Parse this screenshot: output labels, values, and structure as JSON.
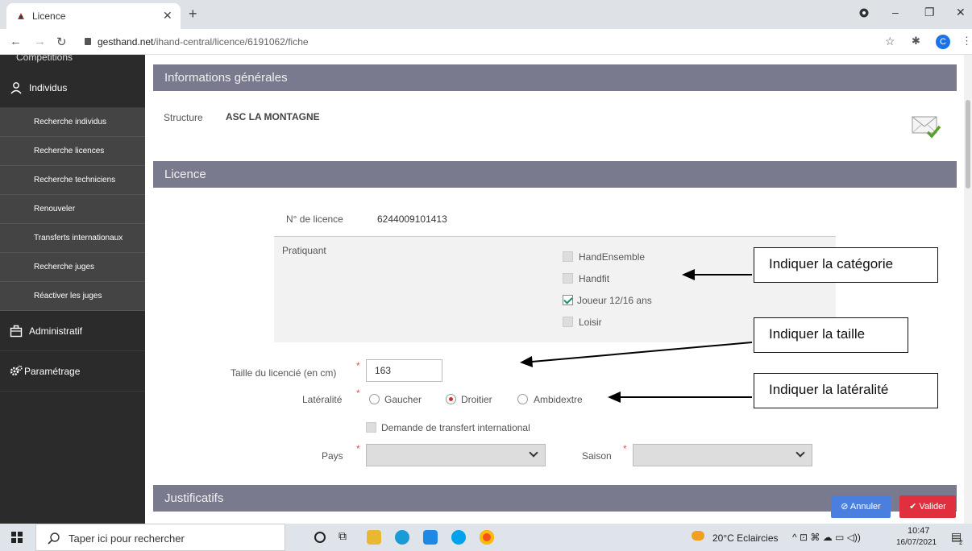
{
  "browser": {
    "tab_title": "Licence",
    "url_host": "gesthand.net",
    "url_path": "/ihand-central/licence/6191062/fiche",
    "profile_initial": "C"
  },
  "sidebar": {
    "top_partial": "Compétitions",
    "sections": [
      {
        "label": "Individus"
      },
      {
        "label": "Administratif"
      },
      {
        "label": "Paramétrage"
      }
    ],
    "items": [
      {
        "label": "Recherche individus"
      },
      {
        "label": "Recherche licences"
      },
      {
        "label": "Recherche techniciens"
      },
      {
        "label": "Renouveler"
      },
      {
        "label": "Transferts internationaux"
      },
      {
        "label": "Recherche juges"
      },
      {
        "label": "Réactiver les juges"
      }
    ]
  },
  "main": {
    "section_general": "Informations générales",
    "structure_label": "Structure",
    "structure_value": "ASC LA MONTAGNE",
    "section_licence": "Licence",
    "licence_no_label": "N° de licence",
    "licence_no_value": "6244009101413",
    "pratiquant_label": "Pratiquant",
    "pratiquant_options": [
      {
        "label": "HandEnsemble",
        "checked": false
      },
      {
        "label": "Handfit",
        "checked": false
      },
      {
        "label": "Joueur 12/16 ans",
        "checked": true
      },
      {
        "label": "Loisir",
        "checked": false
      }
    ],
    "taille_label": "Taille du licencié (en cm)",
    "taille_value": "163",
    "lateralite_label": "Latéralité",
    "lateralite_options": [
      {
        "label": "Gaucher",
        "selected": false
      },
      {
        "label": "Droitier",
        "selected": true
      },
      {
        "label": "Ambidextre",
        "selected": false
      }
    ],
    "transfert_label": "Demande de transfert international",
    "pays_label": "Pays",
    "saison_label": "Saison",
    "section_justificatifs": "Justificatifs",
    "annuler_label": "Annuler",
    "valider_label": "Valider"
  },
  "callouts": {
    "categorie": "Indiquer la catégorie",
    "taille": "Indiquer la taille",
    "lateralite": "Indiquer la latéralité"
  },
  "taskbar": {
    "search_placeholder": "Taper ici pour rechercher",
    "weather": "20°C Eclaircies",
    "time": "10:47",
    "date": "16/07/2021",
    "notif_count": "2"
  },
  "colors": {
    "band": "#7a7a8f",
    "sidebar": "#2b2b2b",
    "annuler": "#4a7fe0",
    "valider": "#e03040"
  }
}
